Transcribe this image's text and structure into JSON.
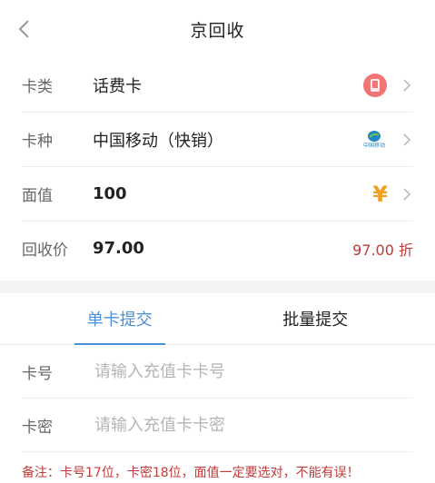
{
  "header": {
    "title": "京回收"
  },
  "rows": [
    {
      "label": "卡类",
      "value": "话费卡"
    },
    {
      "label": "卡种",
      "value": "中国移动（快销）",
      "logo_text": "中国移动"
    },
    {
      "label": "面值",
      "value": "100",
      "icon": "¥"
    },
    {
      "label": "回收价",
      "value": "97.00",
      "discount": "97.00 折"
    }
  ],
  "tabs": [
    {
      "label": "单卡提交"
    },
    {
      "label": "批量提交"
    }
  ],
  "form": {
    "card_no_label": "卡号",
    "card_no_placeholder": "请输入充值卡卡号",
    "card_pwd_label": "卡密",
    "card_pwd_placeholder": "请输入充值卡卡密"
  },
  "note": "备注：卡号17位，卡密18位，面值一定要选对，不能有误！",
  "colors": {
    "accent": "#4a90d9",
    "price": "#c23a3a",
    "yen": "#f0a020"
  }
}
